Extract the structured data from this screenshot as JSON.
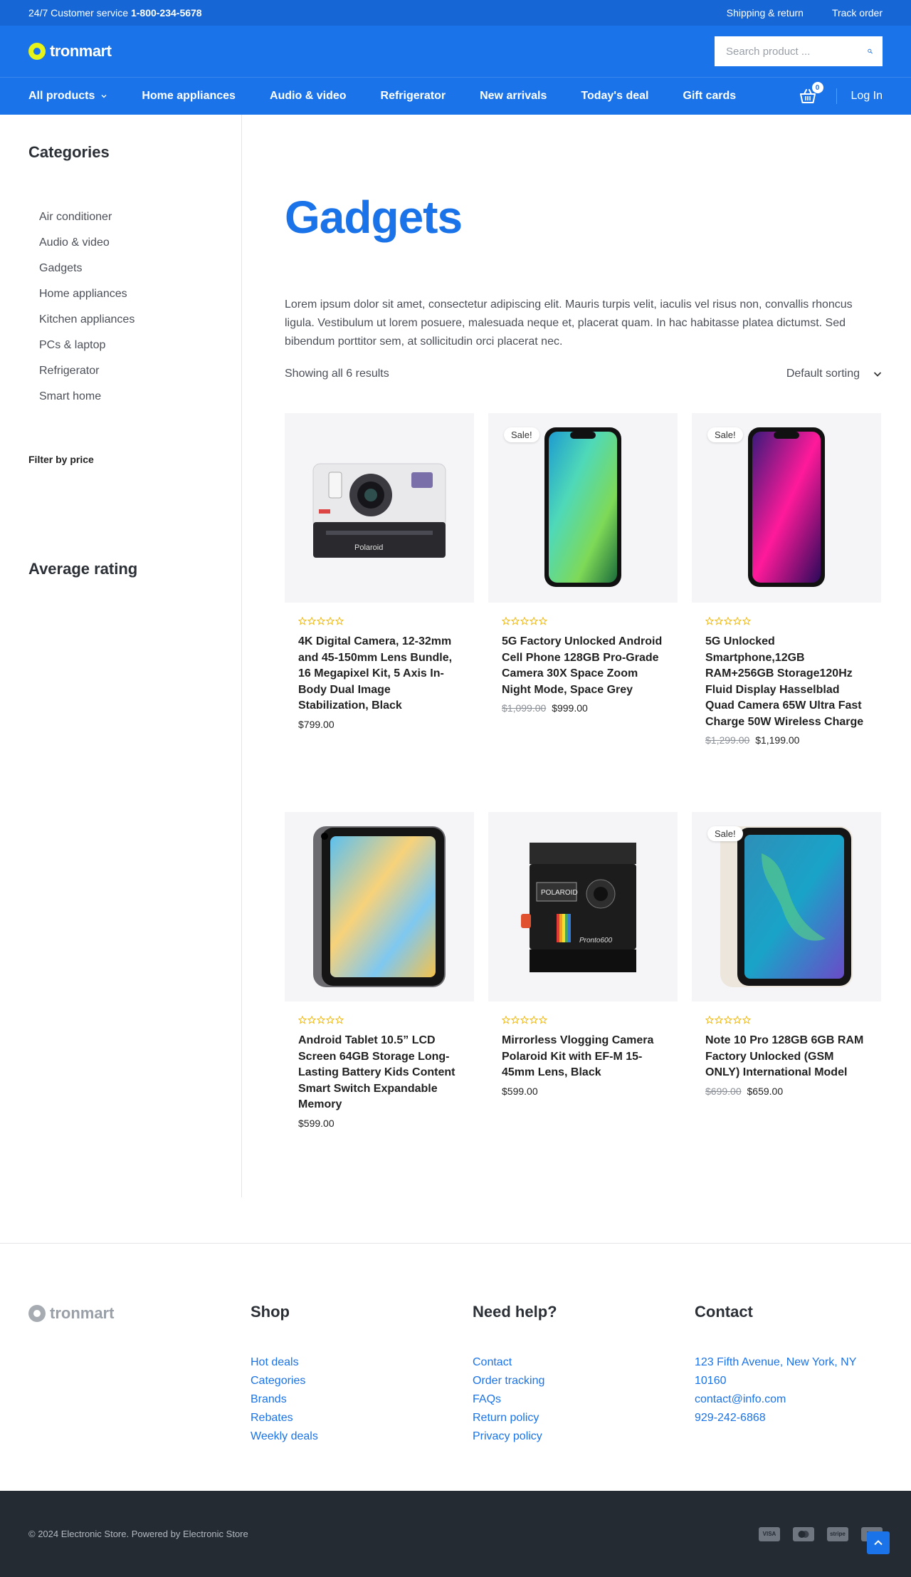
{
  "topbar": {
    "service_text": "24/7 Customer service",
    "phone": "1-800-234-5678",
    "shipping": "Shipping & return",
    "track": "Track order"
  },
  "header": {
    "logo_text": "tronmart",
    "search_placeholder": "Search product ..."
  },
  "nav": {
    "all_products": "All products",
    "items": [
      "Home appliances",
      "Audio & video",
      "Refrigerator",
      "New arrivals",
      "Today's deal",
      "Gift cards"
    ],
    "cart_count": "0",
    "login": "Log In"
  },
  "sidebar": {
    "categories_title": "Categories",
    "categories": [
      "Air conditioner",
      "Audio & video",
      "Gadgets",
      "Home appliances",
      "Kitchen appliances",
      "PCs & laptop",
      "Refrigerator",
      "Smart home"
    ],
    "price_title": "Filter by price",
    "rating_title": "Average rating"
  },
  "content": {
    "title": "Gadgets",
    "description": "Lorem ipsum dolor sit amet, consectetur adipiscing elit. Mauris turpis velit, iaculis vel risus non, convallis rhoncus ligula. Vestibulum ut lorem posuere, malesuada neque et, placerat quam. In hac habitasse platea dictumst. Sed bibendum porttitor sem, at sollicitudin orci placerat nec.",
    "result_count": "Showing all 6 results",
    "sort_label": "Default sorting"
  },
  "products": [
    {
      "name": "4K Digital Camera, 12-32mm and 45-150mm Lens Bundle, 16 Megapixel Kit, 5 Axis In-Body Dual Image Stabilization, Black",
      "old_price": "",
      "price": "$799.00",
      "sale": "",
      "rating": 0
    },
    {
      "name": "5G Factory Unlocked Android Cell Phone 128GB Pro-Grade Camera 30X Space Zoom Night Mode, Space Grey",
      "old_price": "$1,099.00",
      "price": "$999.00",
      "sale": "Sale!",
      "rating": 0
    },
    {
      "name": "5G Unlocked Smartphone,12GB RAM+256GB Storage120Hz Fluid Display Hasselblad Quad Camera 65W Ultra Fast Charge 50W Wireless Charge",
      "old_price": "$1,299.00",
      "price": "$1,199.00",
      "sale": "Sale!",
      "rating": 0
    },
    {
      "name": "Android Tablet 10.5” LCD Screen 64GB Storage Long-Lasting Battery Kids Content Smart Switch Expandable Memory",
      "old_price": "",
      "price": "$599.00",
      "sale": "",
      "rating": 0
    },
    {
      "name": "Mirrorless Vlogging Camera Polaroid Kit with EF-M 15-45mm Lens, Black",
      "old_price": "",
      "price": "$599.00",
      "sale": "",
      "rating": 0
    },
    {
      "name": "Note 10 Pro 128GB 6GB RAM Factory Unlocked (GSM ONLY) International Model",
      "old_price": "$699.00",
      "price": "$659.00",
      "sale": "Sale!",
      "rating": 0
    }
  ],
  "footer": {
    "logo_text": "tronmart",
    "shop_title": "Shop",
    "shop_links": [
      "Hot deals",
      "Categories",
      "Brands",
      "Rebates",
      "Weekly deals"
    ],
    "help_title": "Need help?",
    "help_links": [
      "Contact",
      "Order tracking",
      "FAQs",
      "Return policy",
      "Privacy policy"
    ],
    "contact_title": "Contact",
    "contact_lines": [
      "123 Fifth Avenue, New York, NY 10160",
      "contact@info.com",
      "929-242-6868"
    ],
    "copyright": "© 2024 Electronic Store. Powered by Electronic Store",
    "payments": [
      "VISA",
      "mastercard",
      "stripe",
      "apple-pay"
    ]
  },
  "colors": {
    "brand_blue": "#1a73e8",
    "topbar_blue": "#1666d6",
    "logo_yellow": "#e6f318",
    "footer_dark": "#252b33",
    "star_gold": "#f0b400"
  }
}
